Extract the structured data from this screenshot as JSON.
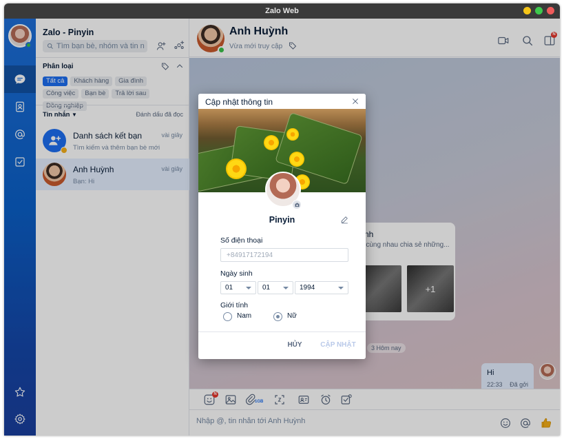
{
  "window": {
    "title": "Zalo Web"
  },
  "panel": {
    "title": "Zalo - Pinyin",
    "search_placeholder": "Tìm bạn bè, nhóm và tin nh...",
    "category_label": "Phân loại",
    "chips": [
      {
        "label": "Tất cả",
        "active": true
      },
      {
        "label": "Khách hàng",
        "active": false
      },
      {
        "label": "Gia đình",
        "active": false
      },
      {
        "label": "Công việc",
        "active": false
      },
      {
        "label": "Bạn bè",
        "active": false
      },
      {
        "label": "Trả lời sau",
        "active": false
      },
      {
        "label": "Đồng nghiệp",
        "active": false
      }
    ],
    "messages_label": "Tin nhắn",
    "mark_read": "Đánh dấu đã đọc",
    "conversations": [
      {
        "name": "Danh sách kết bạn",
        "preview": "Tìm kiếm và thêm bạn bè mới",
        "time": "vài giây"
      },
      {
        "name": "Anh Huỳnh",
        "preview": "Bạn: Hi",
        "time": "vài giây"
      }
    ]
  },
  "chat": {
    "contact_name": "Anh Huỳnh",
    "status": "Vừa mới truy cập",
    "card_title": "ynh",
    "card_subtitle": "u cùng nhau chia sẻ những...",
    "card_more": "+1",
    "time_divider": "3 Hôm nay",
    "bubble_text": "Hi",
    "bubble_time": "22:33",
    "bubble_status": "Đã gởi",
    "toolbar_badge": "N",
    "composer_placeholder": "Nhập @, tin nhắn tới Anh Huỳnh",
    "header_badge": "N",
    "file_size_label": "1GB"
  },
  "modal": {
    "title": "Cập nhật thông tin",
    "display_name": "Pinyin",
    "phone_label": "Số điện thoại",
    "phone_placeholder": "+84917172194",
    "dob_label": "Ngày sinh",
    "dob_day": "01",
    "dob_month": "01",
    "dob_year": "1994",
    "gender_label": "Giới tính",
    "gender_male": "Nam",
    "gender_female": "Nữ",
    "gender_selected": "Nữ",
    "cancel_label": "HỦY",
    "update_label": "CẬP NHẬT"
  },
  "colors": {
    "accent": "#1d6ff2",
    "nav_top": "#1e6fd9",
    "nav_bottom": "#1a3f9e",
    "online": "#3ac14a",
    "badge": "#e6352b"
  },
  "icons": {
    "nav": [
      "chat-icon",
      "contacts-icon",
      "mention-icon",
      "todo-icon",
      "star-icon",
      "settings-icon"
    ],
    "header": [
      "video-call-icon",
      "search-icon",
      "sidebar-toggle-icon"
    ],
    "toolbar": [
      "sticker-icon",
      "image-icon",
      "attachment-icon",
      "screenshot-icon",
      "business-card-icon",
      "reminder-icon",
      "task-icon"
    ],
    "composer": [
      "emoji-icon",
      "mention-icon",
      "thumbs-up-icon"
    ]
  }
}
